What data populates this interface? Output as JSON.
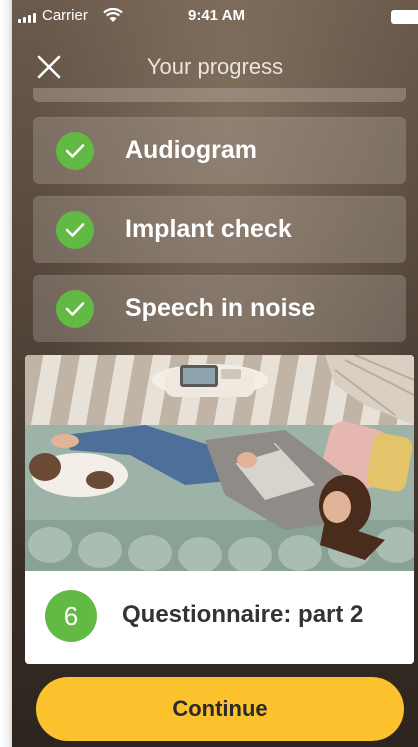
{
  "status_bar": {
    "carrier": "Carrier",
    "time": "9:41 AM"
  },
  "header": {
    "title": "Your progress",
    "close_icon": "close-icon"
  },
  "completed_tasks": [
    {
      "label": "Audiogram",
      "icon": "checkmark-icon"
    },
    {
      "label": "Implant check",
      "icon": "checkmark-icon"
    },
    {
      "label": "Speech in noise",
      "icon": "checkmark-icon"
    }
  ],
  "next_task": {
    "step_number": "6",
    "label": "Questionnaire: part 2",
    "image": "woman-relaxing-on-couch-with-dog"
  },
  "primary_action": {
    "label": "Continue"
  },
  "colors": {
    "accent_green": "#62b944",
    "button_yellow": "#fbc22d"
  }
}
